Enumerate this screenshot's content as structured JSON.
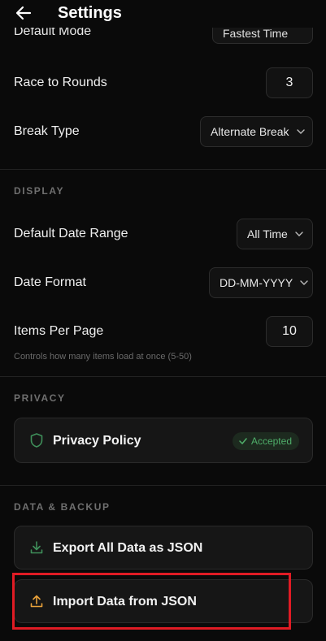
{
  "header": {
    "title": "Settings"
  },
  "game": {
    "default_mode": {
      "label": "Default Mode",
      "value": "Fastest Time"
    },
    "race_to_rounds": {
      "label": "Race to Rounds",
      "value": "3"
    },
    "break_type": {
      "label": "Break Type",
      "value": "Alternate Break"
    }
  },
  "display": {
    "section_title": "DISPLAY",
    "date_range": {
      "label": "Default Date Range",
      "value": "All Time"
    },
    "date_format": {
      "label": "Date Format",
      "value": "DD-MM-YYYY"
    },
    "items_per_page": {
      "label": "Items Per Page",
      "value": "10",
      "hint": "Controls how many items load at once (5-50)"
    }
  },
  "privacy": {
    "section_title": "PRIVACY",
    "policy_label": "Privacy Policy",
    "status_badge": "Accepted"
  },
  "data_backup": {
    "section_title": "DATA & BACKUP",
    "export_label": "Export All Data as JSON",
    "import_label": "Import Data from JSON"
  },
  "colors": {
    "background": "#0a0a0a",
    "accent_green": "#4fae6a",
    "import_icon": "#e8a13a",
    "highlight": "#e01b24"
  },
  "icons": {
    "back": "arrow-left-icon",
    "shield": "shield-icon",
    "check": "check-icon",
    "download": "download-icon",
    "upload": "upload-icon",
    "chevron": "chevron-down-icon"
  }
}
